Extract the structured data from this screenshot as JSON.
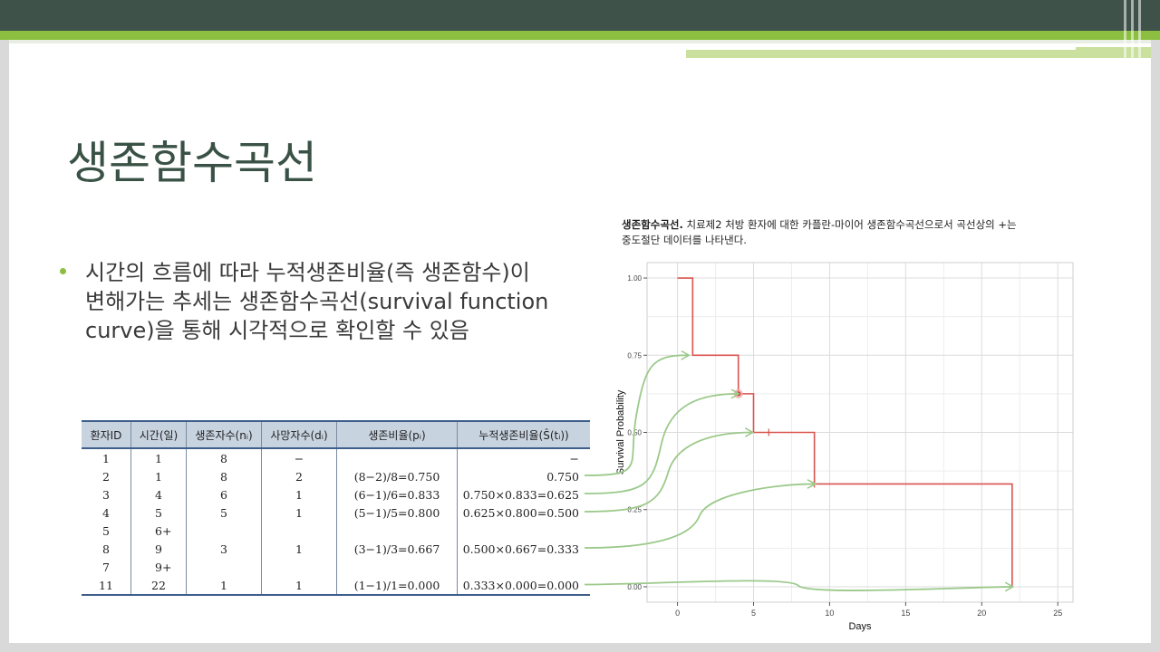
{
  "slide": {
    "title": "생존함수곡선",
    "bullet_lines": [
      "시간의 흐름에 따라 누적생존비율(즉 생존함수)이",
      "변해가는 추세는 생존함수곡선(survival function",
      "curve)을 통해 시각적으로 확인할 수 있음"
    ]
  },
  "caption": {
    "bold": "생존함수곡선.",
    "text_line1": " 치료제2 처방 환자에 대한 카플란-마이어 생존함수곡선으로서 곡선상의 +는",
    "text_line2": "중도절단 데이터를 나타낸다."
  },
  "table": {
    "headers": [
      "환자ID",
      "시간(일)",
      "생존자수(nᵢ)",
      "사망자수(dᵢ)",
      "생존비율(pᵢ)",
      "누적생존비율(Ŝ(tᵢ))"
    ],
    "rows": [
      [
        "1",
        "1",
        "8",
        "−",
        "",
        "−"
      ],
      [
        "2",
        "1",
        "8",
        "2",
        "(8−2)/8=0.750",
        "0.750"
      ],
      [
        "3",
        "4",
        "6",
        "1",
        "(6−1)/6=0.833",
        "0.750×0.833=0.625"
      ],
      [
        "4",
        "5",
        "5",
        "1",
        "(5−1)/5=0.800",
        "0.625×0.800=0.500"
      ],
      [
        "5",
        "6+",
        "",
        "",
        "",
        ""
      ],
      [
        "8",
        "9",
        "3",
        "1",
        "(3−1)/3=0.667",
        "0.500×0.667=0.333"
      ],
      [
        "7",
        "9+",
        "",
        "",
        "",
        ""
      ],
      [
        "11",
        "22",
        "1",
        "1",
        "(1−1)/1=0.000",
        "0.333×0.000=0.000"
      ]
    ]
  },
  "colors": {
    "curve": "#d9534f",
    "arrow": "#9bc98a",
    "title": "#3a5246",
    "accent_green": "#8cbf3f",
    "table_header": "#c8d3e0"
  },
  "chart_data": {
    "type": "line",
    "step": true,
    "xlabel": "Days",
    "ylabel": "Survival Probability",
    "xlim": [
      -2,
      26
    ],
    "ylim": [
      -0.05,
      1.05
    ],
    "x_ticks": [
      0,
      5,
      10,
      15,
      20,
      25
    ],
    "y_ticks": [
      0.0,
      0.25,
      0.5,
      0.75,
      1.0
    ],
    "x_tick_labels": [
      "0",
      "5",
      "10",
      "15",
      "20",
      "25"
    ],
    "y_tick_labels": [
      "0.00",
      "0.25",
      "0.50",
      "0.75",
      "1.00"
    ],
    "grid": true,
    "series": [
      {
        "x": [
          0,
          1,
          1,
          4,
          4,
          5,
          5,
          9,
          9,
          22,
          22
        ],
        "y": [
          1.0,
          1.0,
          0.75,
          0.75,
          0.625,
          0.625,
          0.5,
          0.5,
          0.333,
          0.333,
          0.0
        ]
      }
    ],
    "censored": [
      {
        "x": 6,
        "y": 0.5
      },
      {
        "x": 9,
        "y": 0.333
      }
    ],
    "highlight_point": {
      "x": 4,
      "y": 0.625
    },
    "arrows_to_points": [
      {
        "row": 2,
        "x": 0.7,
        "y": 0.75
      },
      {
        "row": 3,
        "x": 4.0,
        "y": 0.625
      },
      {
        "row": 4,
        "x": 4.9,
        "y": 0.5
      },
      {
        "row": 6,
        "x": 9.0,
        "y": 0.333
      },
      {
        "row": 8,
        "x": 22.0,
        "y": 0.0
      }
    ]
  }
}
